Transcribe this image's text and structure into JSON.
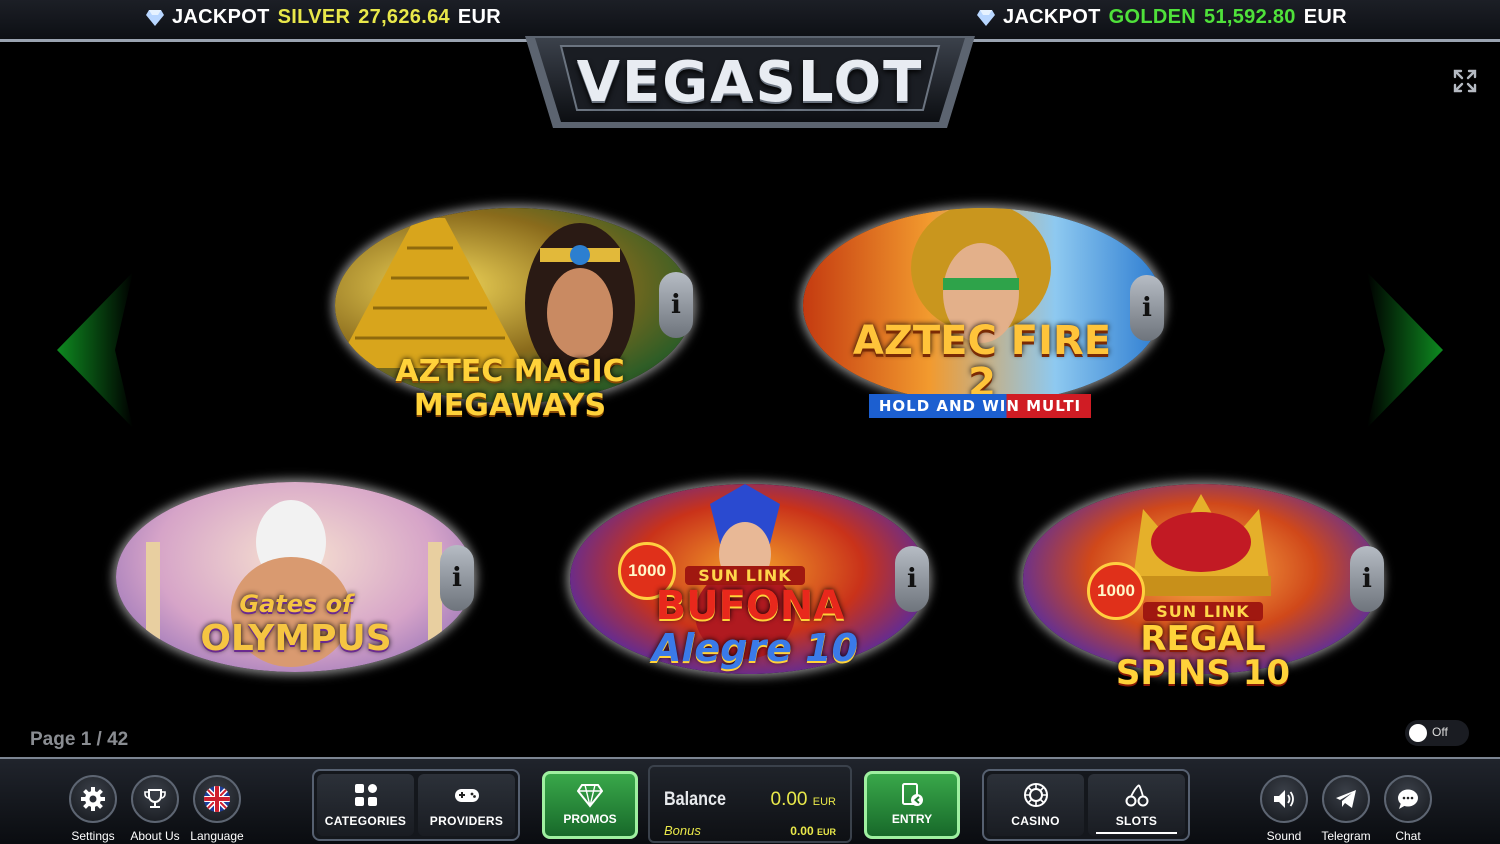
{
  "jackpots": [
    {
      "label": "JACKPOT",
      "tier": "SILVER",
      "value": "27,626.64",
      "currency": "EUR",
      "color": "#e9e84a"
    },
    {
      "label": "JACKPOT",
      "tier": "GOLDEN",
      "value": "51,592.80",
      "currency": "EUR",
      "color": "#4fe13a"
    }
  ],
  "logo": {
    "text": "VEGASLOT"
  },
  "games": [
    {
      "title_line1": "AZTEC MAGIC",
      "title_line2": "MEGAWAYS",
      "info": "i"
    },
    {
      "title_line1": "AZTEC FIRE 2",
      "title_line2": "HOLD AND WIN MULTI",
      "info": "i"
    },
    {
      "title_line1": "Gates of",
      "title_line2": "OLYMPUS",
      "info": "i"
    },
    {
      "badge": "1000",
      "tag": "SUN LINK",
      "title_line1": "BUFONA",
      "title_line2": "Alegre 10",
      "info": "i"
    },
    {
      "badge": "1000",
      "tag": "SUN LINK",
      "title_line1": "REGAL",
      "title_line2": "SPINS 10",
      "info": "i"
    }
  ],
  "pagination": {
    "label": "Page 1 / 42"
  },
  "toggle": {
    "label": "Off"
  },
  "bottom": {
    "settings": "Settings",
    "about": "About Us",
    "language": "Language",
    "categories": "CATEGORIES",
    "providers": "PROVIDERS",
    "promos": "PROMOS",
    "balance_label": "Balance",
    "balance_value": "0.00",
    "balance_currency": "EUR",
    "bonus_label": "Bonus",
    "bonus_value": "0.00",
    "bonus_currency": "EUR",
    "entry": "ENTRY",
    "casino": "CASINO",
    "slots": "SLOTS",
    "sound": "Sound",
    "telegram": "Telegram",
    "chat": "Chat"
  },
  "icons": [
    "diamond-icon",
    "fullscreen-icon",
    "arrow-left-icon",
    "arrow-right-icon",
    "info-icon",
    "gear-icon",
    "trophy-icon",
    "uk-flag-icon",
    "grid-icon",
    "gamepad-icon",
    "gem-icon",
    "door-entry-icon",
    "roulette-icon",
    "cherries-icon",
    "speaker-icon",
    "telegram-icon",
    "chat-bubble-icon"
  ]
}
